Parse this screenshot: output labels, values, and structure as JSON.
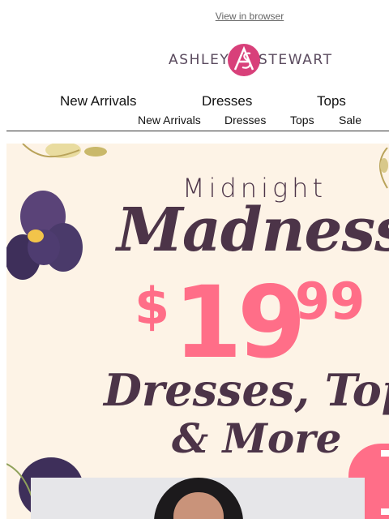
{
  "header": {
    "view_in_browser": "View in browser",
    "logo": {
      "word_left": "ASHLEY",
      "word_right": "STEWART",
      "monogram": "AS"
    }
  },
  "nav_primary": [
    "New Arrivals",
    "Dresses",
    "Tops"
  ],
  "nav_secondary": [
    "New Arrivals",
    "Dresses",
    "Tops",
    "Sale"
  ],
  "hero": {
    "line1": "Midnight",
    "line2": "Madness",
    "price": {
      "currency": "$",
      "dollars": "19",
      "cents": "99"
    },
    "line4": "Dresses, Tops",
    "line5": "& More"
  },
  "colors": {
    "accent_pink": "#ff6e88",
    "plum": "#4c3448",
    "cream": "#fdf3e6",
    "violet": "#4a3a6a"
  }
}
